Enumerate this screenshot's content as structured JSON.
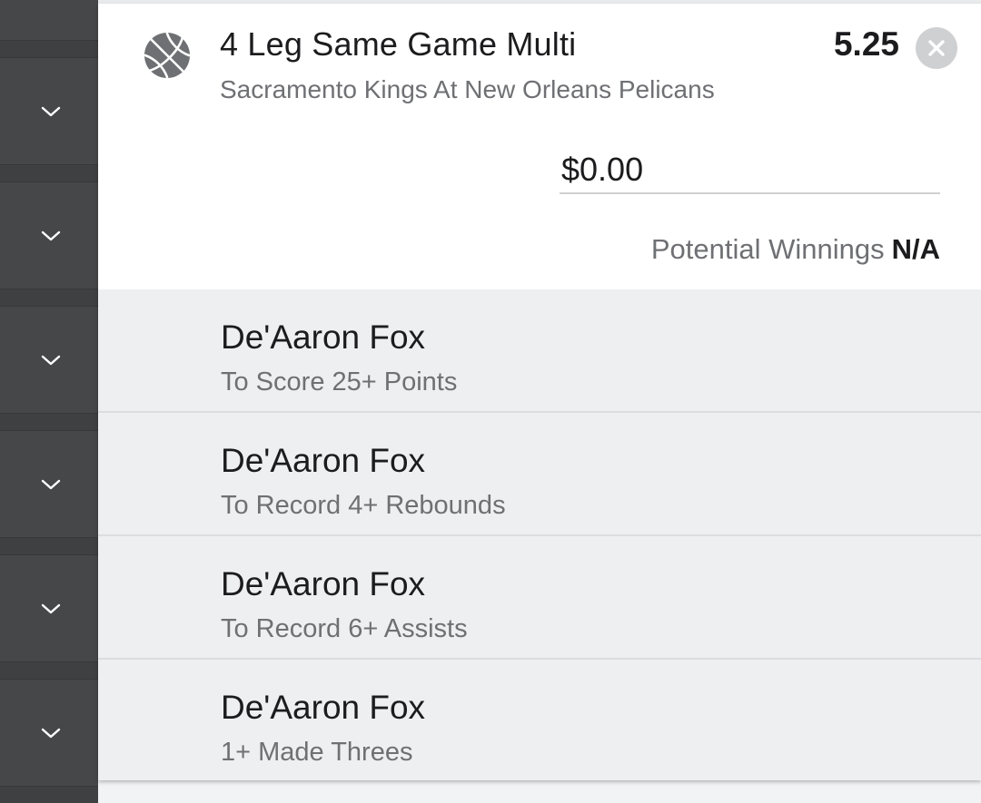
{
  "bet": {
    "title": "4 Leg Same Game Multi",
    "match": "Sacramento Kings At New Orleans Pelicans",
    "odds": "5.25",
    "sport_icon": "basketball-icon",
    "close_icon": "close-icon"
  },
  "stake": {
    "value": "$0.00"
  },
  "winnings": {
    "label": "Potential Winnings",
    "value": "N/A"
  },
  "legs": [
    {
      "player": "De'Aaron Fox",
      "market": "To Score 25+ Points"
    },
    {
      "player": "De'Aaron Fox",
      "market": "To Record 4+ Rebounds"
    },
    {
      "player": "De'Aaron Fox",
      "market": "To Record 6+ Assists"
    },
    {
      "player": "De'Aaron Fox",
      "market": "1+ Made Threes"
    }
  ],
  "rail": {
    "chevron_icon": "chevron-down-icon"
  },
  "colors": {
    "rail": "#464749",
    "legs_background": "#eeeff1",
    "primary_text": "#1c1c1e",
    "secondary_text": "#6f7073",
    "close_button": "#cfd0d2",
    "sport_icon": "#6f7073"
  }
}
